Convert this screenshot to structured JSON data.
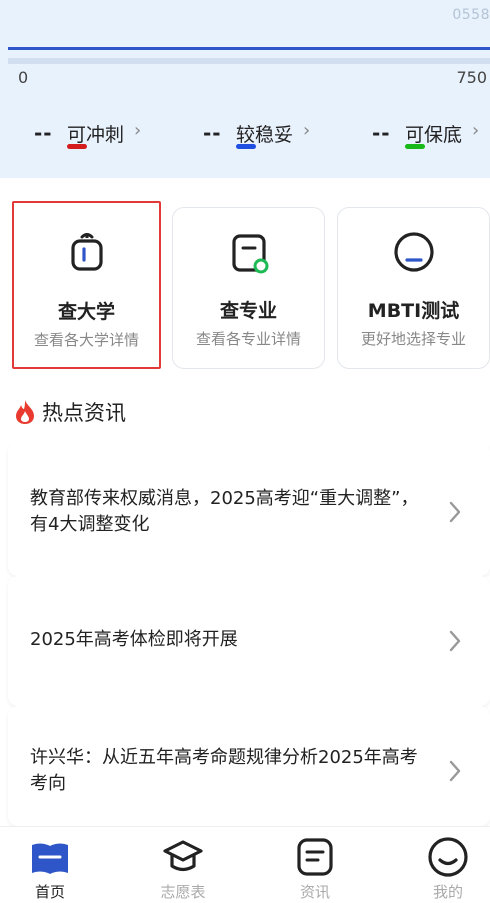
{
  "hero": {
    "watermark": "0558",
    "score_min": "0",
    "score_max": "750",
    "categories": [
      {
        "value": "--",
        "label": "可冲刺",
        "chevron": "›",
        "color": "#d41c1c"
      },
      {
        "value": "--",
        "label": "较稳妥",
        "chevron": "›",
        "color": "#1f4fe0"
      },
      {
        "value": "--",
        "label": "可保底",
        "chevron": "›",
        "color": "#17b817"
      }
    ]
  },
  "cards": [
    {
      "title": "查大学",
      "subtitle": "查看各大学详情",
      "icon": "school-bag-icon"
    },
    {
      "title": "查专业",
      "subtitle": "查看各专业详情",
      "icon": "major-doc-icon"
    },
    {
      "title": "MBTI测试",
      "subtitle": "更好地选择专业",
      "icon": "mbti-face-icon"
    }
  ],
  "news_section": {
    "title": "热点资讯",
    "icon": "fire-icon",
    "items": [
      {
        "text": "教育部传来权威消息，2025高考迎“重大调整”，有4大调整变化"
      },
      {
        "text": "2025年高考体检即将开展"
      },
      {
        "text": "许兴华：从近五年高考命题规律分析2025年高考考向"
      }
    ]
  },
  "tabbar": {
    "tabs": [
      {
        "label": "首页",
        "icon": "home-book-icon",
        "active": true
      },
      {
        "label": "志愿表",
        "icon": "graduation-cap-icon",
        "active": false
      },
      {
        "label": "资讯",
        "icon": "news-doc-icon",
        "active": false
      },
      {
        "label": "我的",
        "icon": "profile-smile-icon",
        "active": false
      }
    ]
  },
  "colors": {
    "accent": "#2f56c8",
    "hero_bg": "#e8f2fd",
    "selected_border": "#e23838"
  }
}
